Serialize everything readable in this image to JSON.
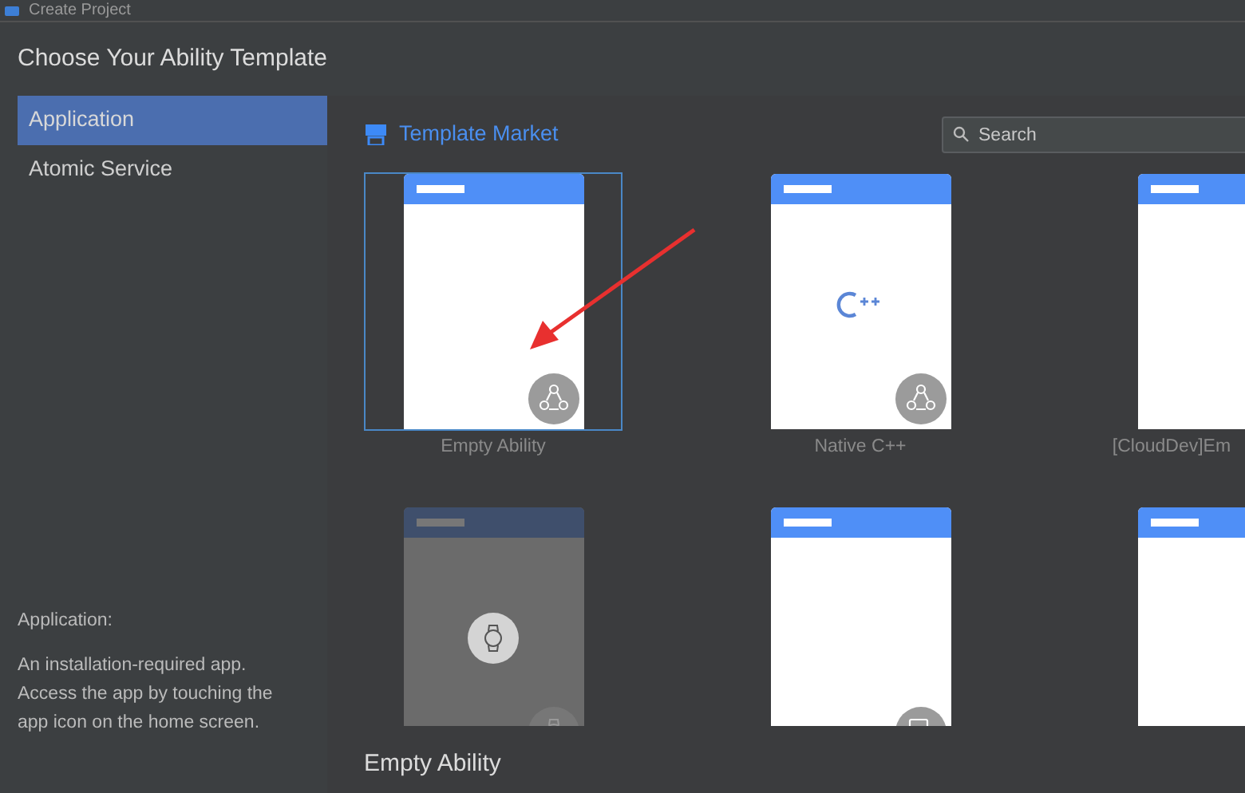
{
  "window": {
    "title": "Create Project"
  },
  "heading": "Choose Your Ability Template",
  "sidebar": {
    "items": [
      {
        "label": "Application",
        "selected": true
      },
      {
        "label": "Atomic Service",
        "selected": false
      }
    ],
    "description": {
      "title": "Application:",
      "text": "An installation-required app. Access the app by touching the app icon on the home screen."
    }
  },
  "template_market": {
    "label": "Template Market"
  },
  "search": {
    "placeholder": "Search"
  },
  "templates": [
    {
      "label": "Empty Ability",
      "selected": true,
      "disabled": false,
      "kind": "blank",
      "badge": {
        "kind": "multi"
      }
    },
    {
      "label": "Native C++",
      "selected": false,
      "disabled": false,
      "kind": "cpp",
      "badge": {
        "kind": "multi"
      }
    },
    {
      "label": "[CloudDev]Em",
      "selected": false,
      "disabled": false,
      "kind": "blank"
    },
    {
      "selected": false,
      "disabled": true,
      "kind": "watch",
      "badge": {
        "kind": "watch"
      }
    },
    {
      "selected": false,
      "disabled": false,
      "kind": "blank",
      "badge": {
        "kind": "tablet"
      }
    },
    {
      "selected": false,
      "disabled": false,
      "kind": "blank"
    }
  ],
  "details": {
    "title": "Empty Ability"
  }
}
